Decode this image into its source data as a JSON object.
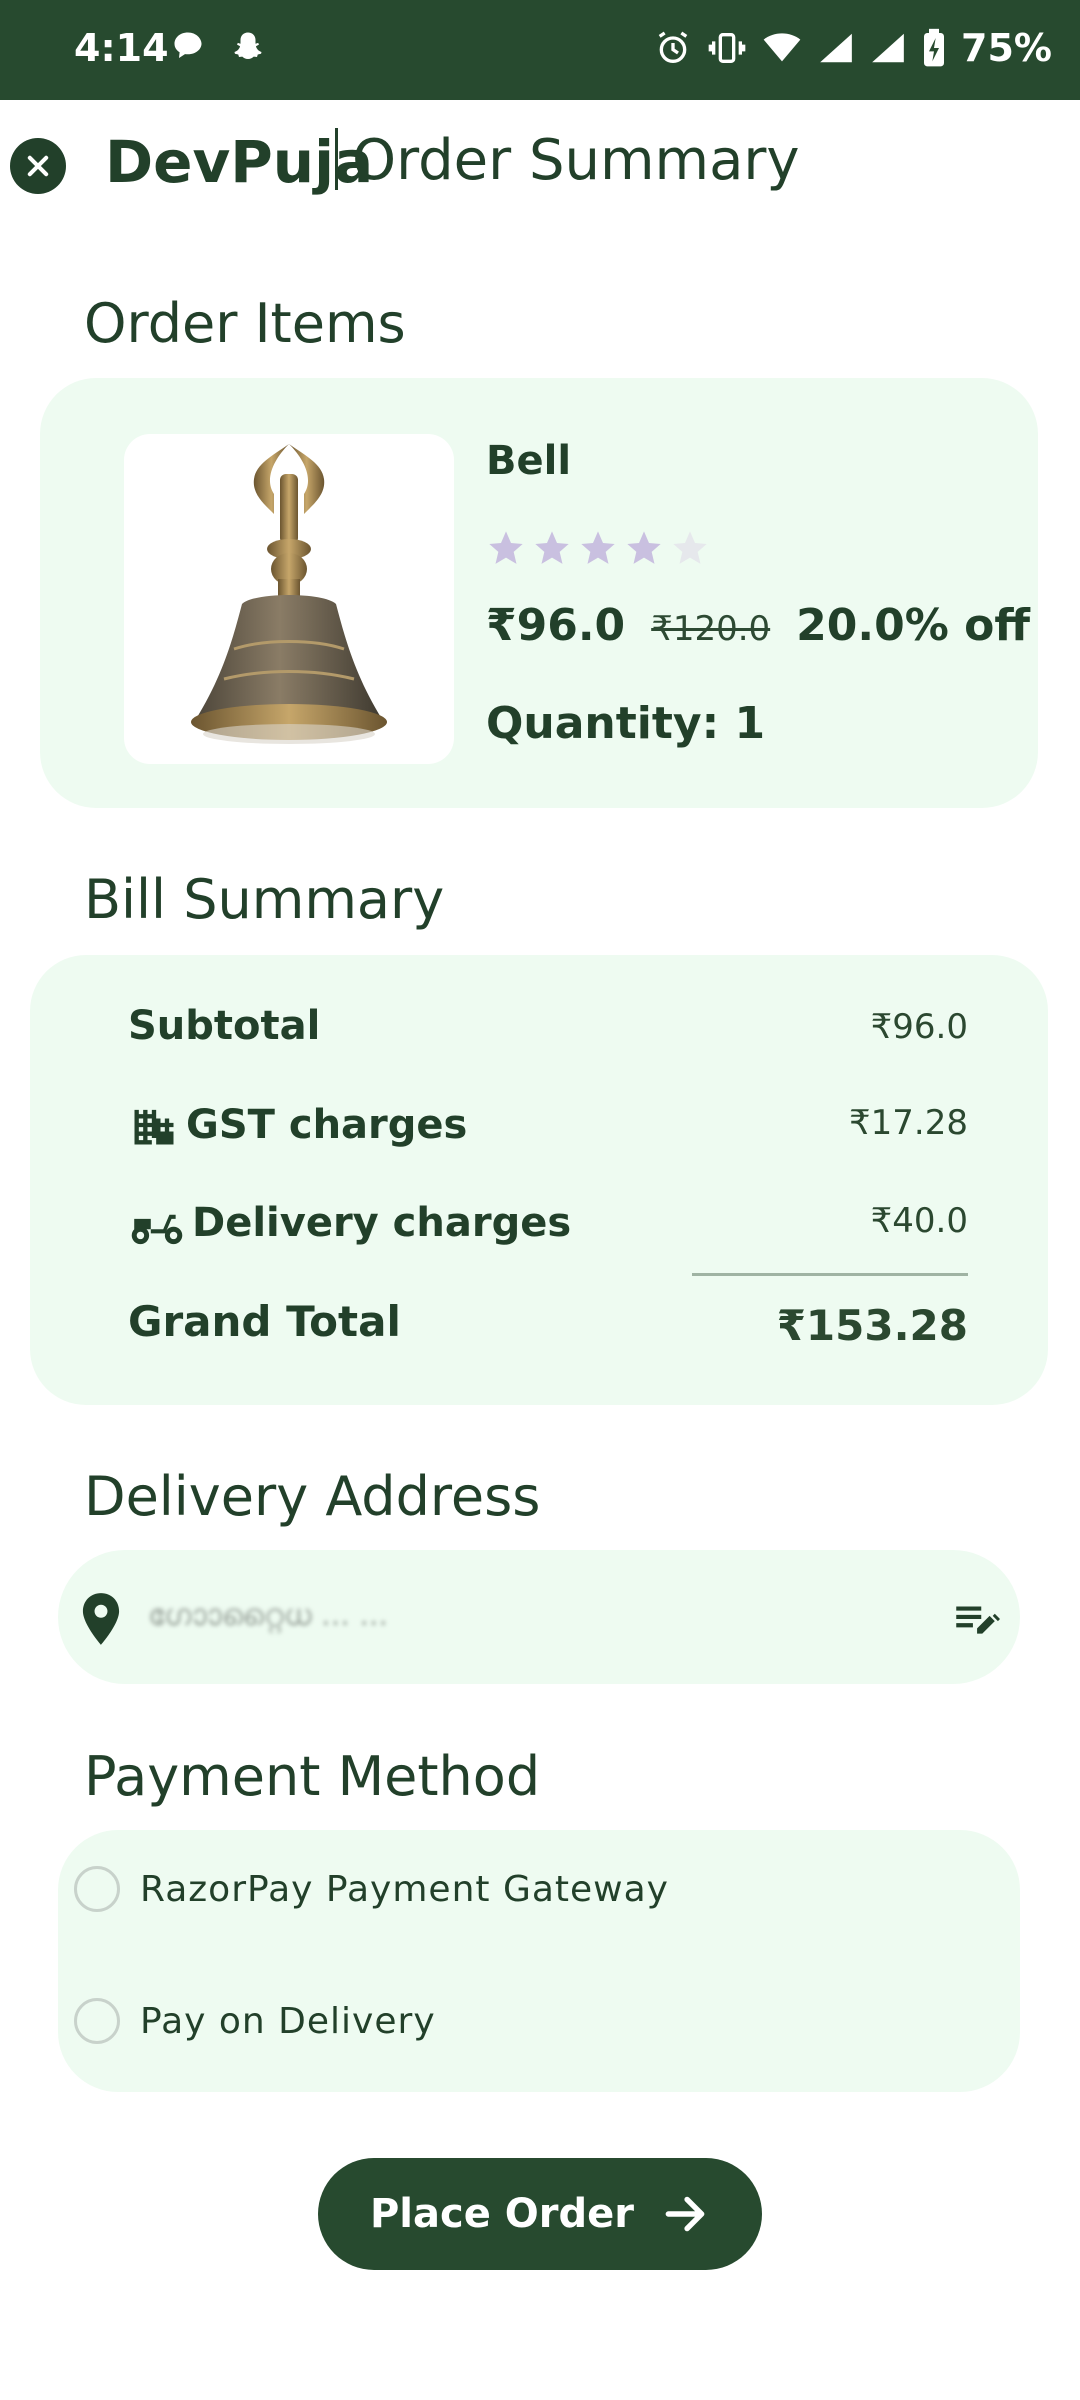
{
  "status_bar": {
    "time": "4:14",
    "battery": "75%"
  },
  "header": {
    "brand": "DevPuja",
    "title": "Order Summary"
  },
  "order_items": {
    "section_title": "Order Items",
    "item": {
      "name": "Bell",
      "rating": 4,
      "rating_max": 5,
      "price": "₹96.0",
      "original_price": "₹120.0",
      "discount": "20.0% off",
      "quantity": "Quantity: 1"
    }
  },
  "bill_summary": {
    "section_title": "Bill Summary",
    "subtotal_label": "Subtotal",
    "subtotal_value": "₹96.0",
    "gst_label": "GST charges",
    "gst_value": "₹17.28",
    "delivery_label": "Delivery charges",
    "delivery_value": "₹40.0",
    "grand_total_label": "Grand Total",
    "grand_total_value": "₹153.28"
  },
  "delivery_address": {
    "section_title": "Delivery Address",
    "address": "ഗാോറ്റൈധ ...                                   ..."
  },
  "payment_method": {
    "section_title": "Payment Method",
    "options": [
      "RazorPay Payment Gateway",
      "Pay on Delivery"
    ]
  },
  "place_order": {
    "label": "Place Order"
  },
  "colors": {
    "primary": "#274a2f",
    "card_bg": "#eefbf1",
    "star_filled": "#c9c0e0",
    "star_empty": "#e6e8ec"
  }
}
